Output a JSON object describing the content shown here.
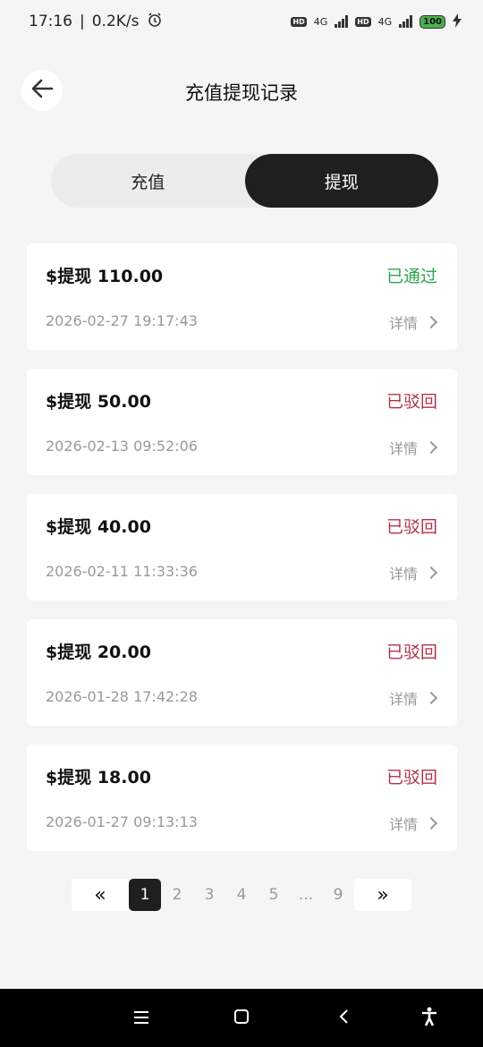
{
  "status_bar": {
    "time": "17:16",
    "separator": "|",
    "speed": "0.2K/s",
    "hd1": "HD",
    "net1": "4G",
    "hd2": "HD",
    "net2": "4G",
    "battery": "100"
  },
  "header": {
    "title": "充值提现记录"
  },
  "tabs": [
    {
      "label": "充值",
      "active": false
    },
    {
      "label": "提现",
      "active": true
    }
  ],
  "records": [
    {
      "amount": "$提现 110.00",
      "status": "已通过",
      "status_color": "#2ea44f",
      "time": "2026-02-27 19:17:43",
      "detail": "详情"
    },
    {
      "amount": "$提现 50.00",
      "status": "已驳回",
      "status_color": "#b3324a",
      "time": "2026-02-13 09:52:06",
      "detail": "详情"
    },
    {
      "amount": "$提现 40.00",
      "status": "已驳回",
      "status_color": "#b3324a",
      "time": "2026-02-11 11:33:36",
      "detail": "详情"
    },
    {
      "amount": "$提现 20.00",
      "status": "已驳回",
      "status_color": "#b3324a",
      "time": "2026-01-28 17:42:28",
      "detail": "详情"
    },
    {
      "amount": "$提现 18.00",
      "status": "已驳回",
      "status_color": "#b3324a",
      "time": "2026-01-27 09:13:13",
      "detail": "详情"
    }
  ],
  "pagination": {
    "first": "«",
    "pages": [
      "1",
      "2",
      "3",
      "4",
      "5",
      "...",
      "9"
    ],
    "current": "1",
    "last": "»"
  },
  "colors": {
    "accent_dark": "#1f1f1f",
    "approved": "#2ea44f",
    "rejected": "#b3324a"
  }
}
